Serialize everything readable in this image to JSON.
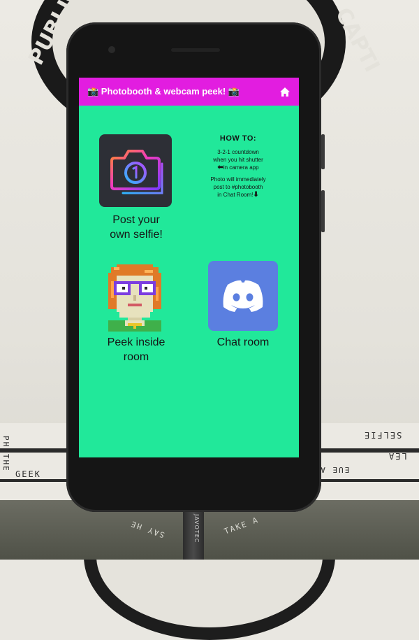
{
  "app": {
    "title": "📸 Photobooth & webcam peek! 📸",
    "home_icon": "home-icon",
    "colors": {
      "appbar": "#e21de0",
      "background": "#21e89a",
      "discord": "#5b7fe0"
    }
  },
  "tiles": {
    "selfie": {
      "label_line1": "Post your",
      "label_line2": "own selfie!",
      "icon": "camera-app-icon"
    },
    "peek": {
      "label_line1": "Peek inside",
      "label_line2": "room",
      "icon": "pixel-avatar-icon"
    },
    "chat": {
      "label": "Chat room",
      "icon": "discord-icon"
    }
  },
  "howto": {
    "title": "HOW TO:",
    "step1_line1": "3-2-1 countdown",
    "step1_line2": "when you hit shutter",
    "step1_line3": "in camera app",
    "step2_line1": "Photo will immediately",
    "step2_line2": "post to #photobooth",
    "step2_line3": "in Chat Room!"
  },
  "background_text": {
    "badge": "PUBLIC",
    "badge_right": "CAPTI",
    "sticker_left_1": "PH THE",
    "sticker_left_2": "GEEK",
    "sticker_right_1": "SELFIE",
    "sticker_right_2": "LEA",
    "sticker_mid": "EUE A S",
    "sticker_bottom": "TAKE A",
    "sticker_bottom_2": "SAY HE",
    "cable": "JAVOTEC"
  }
}
